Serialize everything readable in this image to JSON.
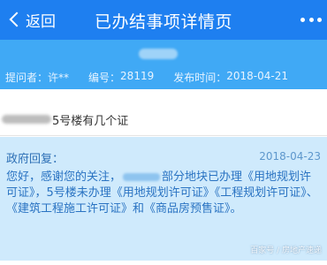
{
  "nav": {
    "back_label": "返回",
    "title": "已办结事项详情页"
  },
  "header": {
    "asker_label": "提问者：",
    "asker_value": "许**",
    "number_label": "编号：",
    "number_value": "28119",
    "publish_label": "发布时间：",
    "publish_value": "2018-04-21"
  },
  "question": {
    "text": "5号楼有几个证"
  },
  "reply": {
    "label": "政府回复：",
    "date": "2018-04-23",
    "body_part1": "您好，感谢您的关注，",
    "body_part2": "部分地块已办理《用地规划许可证》，5号楼未办理《用地规划许可证》《工程规划许可证》、《建筑工程施工许可证》和《商品房预售证》。"
  },
  "watermark": "百家号 / 房地产速递",
  "colors": {
    "navbar": "#1e7ff0",
    "header": "#40a9f5",
    "reply_bg": "#cfeafc",
    "reply_text": "#2a73c2"
  },
  "icons": {
    "back": "chevron-left-icon",
    "more": "more-dots-icon"
  }
}
